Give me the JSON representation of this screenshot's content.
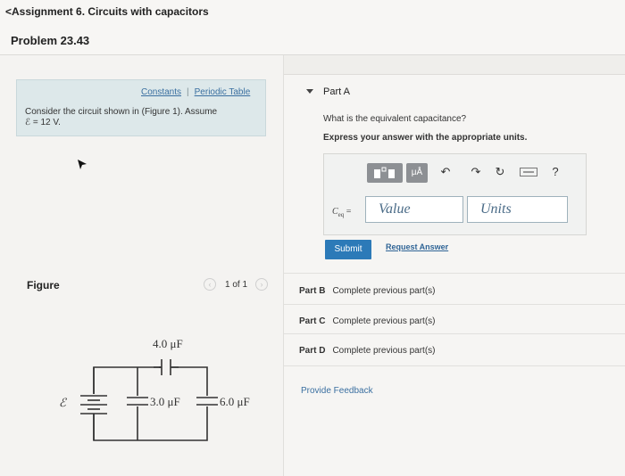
{
  "header": {
    "back_link": "<Assignment 6. Circuits with capacitors",
    "problem_title": "Problem 23.43"
  },
  "intro": {
    "links": [
      "Constants",
      "Periodic Table"
    ],
    "separator": "|",
    "text_line1": "Consider the circuit shown in (Figure 1). Assume",
    "text_line2": "ℰ = 12 V."
  },
  "figure": {
    "label": "Figure",
    "pager_text": "1 of 1",
    "prev_icon": "chevron-left-icon",
    "next_icon": "chevron-right-icon",
    "emf_symbol": "ℰ",
    "cap_top": "4.0 μF",
    "cap_middle": "3.0 μF",
    "cap_right": "6.0 μF"
  },
  "part_a": {
    "title": "Part A",
    "question": "What is the equivalent capacitance?",
    "instruction": "Express your answer with the appropriate units.",
    "units_button": "μÅ",
    "help_icon": "?",
    "ceq_label": "C",
    "ceq_sub": "eq",
    "ceq_equals": "=",
    "value_placeholder": "Value",
    "units_placeholder": "Units",
    "submit_label": "Submit",
    "request_answer": "Request Answer"
  },
  "other_parts": [
    {
      "label": "Part B",
      "status": "Complete previous part(s)"
    },
    {
      "label": "Part C",
      "status": "Complete previous part(s)"
    },
    {
      "label": "Part D",
      "status": "Complete previous part(s)"
    }
  ],
  "feedback_link": "Provide Feedback",
  "colors": {
    "submit_blue": "#2c7ab8",
    "link_blue": "#3a6fa0",
    "intro_bg": "#dde8ea"
  }
}
